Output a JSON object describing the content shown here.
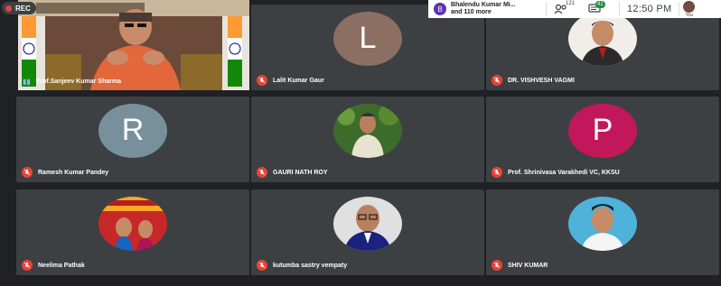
{
  "recording": {
    "label": "REC"
  },
  "topbar": {
    "presenter_initial": "B",
    "presenter_line1": "Bhalendu Kumar Mi...",
    "presenter_line2": "and 110 more",
    "participants_count": "121",
    "chat_count": "41",
    "time": "12:50 PM",
    "self_label": "You"
  },
  "participants": [
    {
      "name": "Prof.Sanjeev Kumar Sharma"
    },
    {
      "name": "Lalit Kumar Gaur",
      "initial": "L",
      "color": "#8d6e63"
    },
    {
      "name": "DR. VISHVESH VAGMI"
    },
    {
      "name": "Ramesh Kumar Pandey",
      "initial": "R",
      "color": "#78909c"
    },
    {
      "name": "GAURI NATH ROY"
    },
    {
      "name": "Prof. Shrinivasa Varakhedi VC, KKSU",
      "initial": "P",
      "color": "#c2185b"
    },
    {
      "name": "Neelima Pathak"
    },
    {
      "name": "kutumba sastry vempaty"
    },
    {
      "name": "SHIV KUMAR"
    }
  ]
}
